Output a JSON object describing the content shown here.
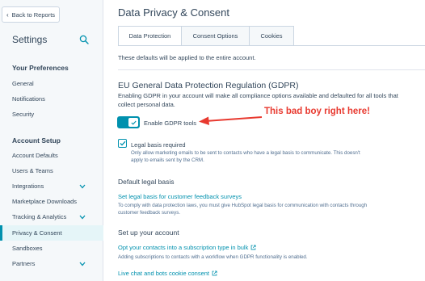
{
  "sidebar": {
    "back_label": "Back to Reports",
    "title": "Settings",
    "sections": [
      {
        "heading": "Your Preferences",
        "items": [
          "General",
          "Notifications",
          "Security"
        ]
      },
      {
        "heading": "Account Setup",
        "items": [
          "Account Defaults",
          "Users & Teams",
          "Integrations",
          "Marketplace Downloads",
          "Tracking & Analytics",
          "Privacy & Consent",
          "Sandboxes",
          "Partners"
        ]
      }
    ],
    "active_item": "Privacy & Consent"
  },
  "main": {
    "title": "Data Privacy & Consent",
    "tabs": [
      "Data Protection",
      "Consent Options",
      "Cookies"
    ],
    "active_tab": "Data Protection",
    "note": "These defaults will be applied to the entire account.",
    "gdpr": {
      "heading": "EU General Data Protection Regulation (GDPR)",
      "description": "Enabling GDPR in your account will make all compliance options available and defaulted for all tools that collect personal data.",
      "toggle_label": "Enable GDPR tools",
      "toggle_on": true
    },
    "annotation": "This bad boy right here!",
    "legal_basis_required": {
      "label": "Legal basis required",
      "description": "Only allow marketing emails to be sent to contacts who have a legal basis to communicate. This doesn't apply to emails sent by the CRM.",
      "checked": true
    },
    "default_legal_basis": {
      "heading": "Default legal basis",
      "link": "Set legal basis for customer feedback surveys",
      "description": "To comply with data protection laws, you must give HubSpot legal basis for communication with contacts through customer feedback surveys."
    },
    "account": {
      "heading": "Set up your account",
      "link": "Opt your contacts into a subscription type in bulk",
      "description": "Adding subscriptions to contacts with a workflow when GDPR functionality is enabled.",
      "link2": "Live chat and bots cookie consent"
    }
  },
  "colors": {
    "accent": "#0091ae",
    "annotation": "#e8392f",
    "text": "#33475b",
    "sidebar_bg": "#f5f8fa"
  }
}
